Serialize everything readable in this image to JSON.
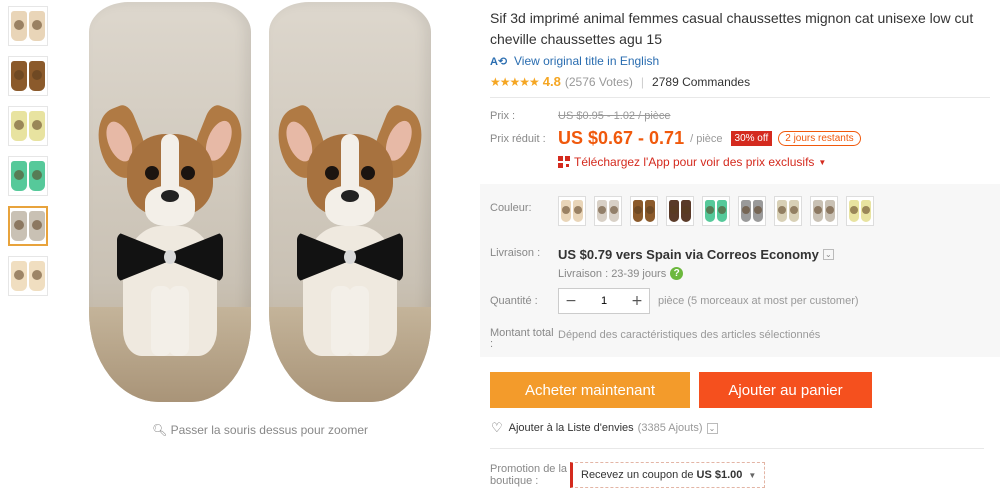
{
  "thumbnails": [
    {
      "color": "#e9d5b8",
      "dog": "brown-yorkie",
      "active": false
    },
    {
      "color": "#8b5a2b",
      "dog": "brown-dog",
      "active": false
    },
    {
      "color": "#e8e3a0",
      "dog": "pug-yellow",
      "active": false
    },
    {
      "color": "#56c99a",
      "dog": "pug-green",
      "active": false
    },
    {
      "color": "#c9c1b4",
      "dog": "chihuahua",
      "active": true
    },
    {
      "color": "#f0dec0",
      "dog": "beige-dog",
      "active": false
    }
  ],
  "image": {
    "zoom_hint": "Passer la souris dessus pour zoomer",
    "zoom_icon": "magnifier-icon"
  },
  "product": {
    "title": "Sif 3d imprimé animal femmes casual chaussettes mignon cat unisexe low cut cheville chaussettes agu 15",
    "view_original": "View original title in English",
    "rating": "4.8",
    "votes": "(2576 Votes)",
    "orders": "2789 Commandes"
  },
  "price": {
    "label": "Prix :",
    "original": "US $0.95 - 1.02 / pièce",
    "sale_label": "Prix réduit :",
    "sale": "US $0.67 - 0.71",
    "per": "/ pièce",
    "discount": "30% off",
    "days_left": "2 jours restants",
    "app_promo": "Téléchargez l'App pour voir des prix exclusifs"
  },
  "color": {
    "label": "Couleur:",
    "swatches": [
      {
        "color": "#e9d5b8"
      },
      {
        "color": "#d8d0c6"
      },
      {
        "color": "#8b5a2b"
      },
      {
        "color": "#5a3a28"
      },
      {
        "color": "#56c99a"
      },
      {
        "color": "#9a9a9a"
      },
      {
        "color": "#d8d0b6"
      },
      {
        "color": "#c9c1b4"
      },
      {
        "color": "#e8e3a0"
      }
    ]
  },
  "shipping": {
    "label": "Livraison :",
    "main": "US $0.79 vers Spain via Correos Economy",
    "sub": "Livraison : 23-39 jours"
  },
  "quantity": {
    "label": "Quantité :",
    "value": "1",
    "note": "pièce (5 morceaux at most per customer)"
  },
  "total": {
    "label": "Montant total :",
    "value": "Dépend des caractéristiques des articles sélectionnés"
  },
  "buttons": {
    "buy": "Acheter maintenant",
    "cart": "Ajouter au panier"
  },
  "wishlist": {
    "label": "Ajouter à la Liste d'envies",
    "count": "(3385 Ajouts)"
  },
  "promo": {
    "label": "Promotion de la boutique :",
    "coupon_prefix": "Recevez un coupon de",
    "coupon_amount": "US $1.00"
  },
  "colors": {
    "accent": "#f0590c",
    "buy": "#f39b2b",
    "cart": "#f5501e",
    "link": "#2a6db0"
  }
}
